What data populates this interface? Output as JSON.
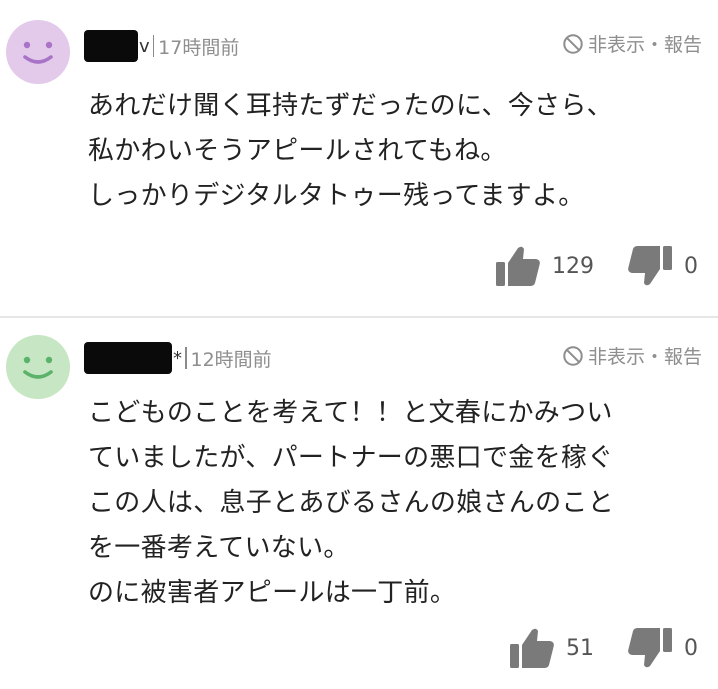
{
  "comments": [
    {
      "avatar_color": "#e3c9ea",
      "avatar_face_color": "#a974c8",
      "name_suffix": "v",
      "timestamp": "17時間前",
      "report_label": "非表示・報告",
      "lines": [
        "あれだけ聞く耳持たずだったのに、今さら、",
        "私かわいそうアピールされてもね。",
        "しっかりデジタルタトゥー残ってますよ。"
      ],
      "likes": "129",
      "dislikes": "0"
    },
    {
      "avatar_color": "#c6e6c4",
      "avatar_face_color": "#5bb26a",
      "name_suffix": "*",
      "timestamp": "12時間前",
      "report_label": "非表示・報告",
      "lines": [
        "こどものことを考えて！！と文春にかみつい",
        "ていましたが、パートナーの悪口で金を稼ぐ",
        "この人は、息子とあびるさんの娘さんのこと",
        "を一番考えていない。",
        "のに被害者アピールは一丁前。"
      ],
      "likes": "51",
      "dislikes": "0"
    }
  ],
  "icons": {
    "avatar": "smiley-face-icon",
    "report": "prohibited-icon",
    "like": "thumbs-up-icon",
    "dislike": "thumbs-down-icon"
  },
  "colors": {
    "meta_gray": "#8e8e8e",
    "icon_gray": "#7a7a7a",
    "divider": "#e6e6e6"
  }
}
